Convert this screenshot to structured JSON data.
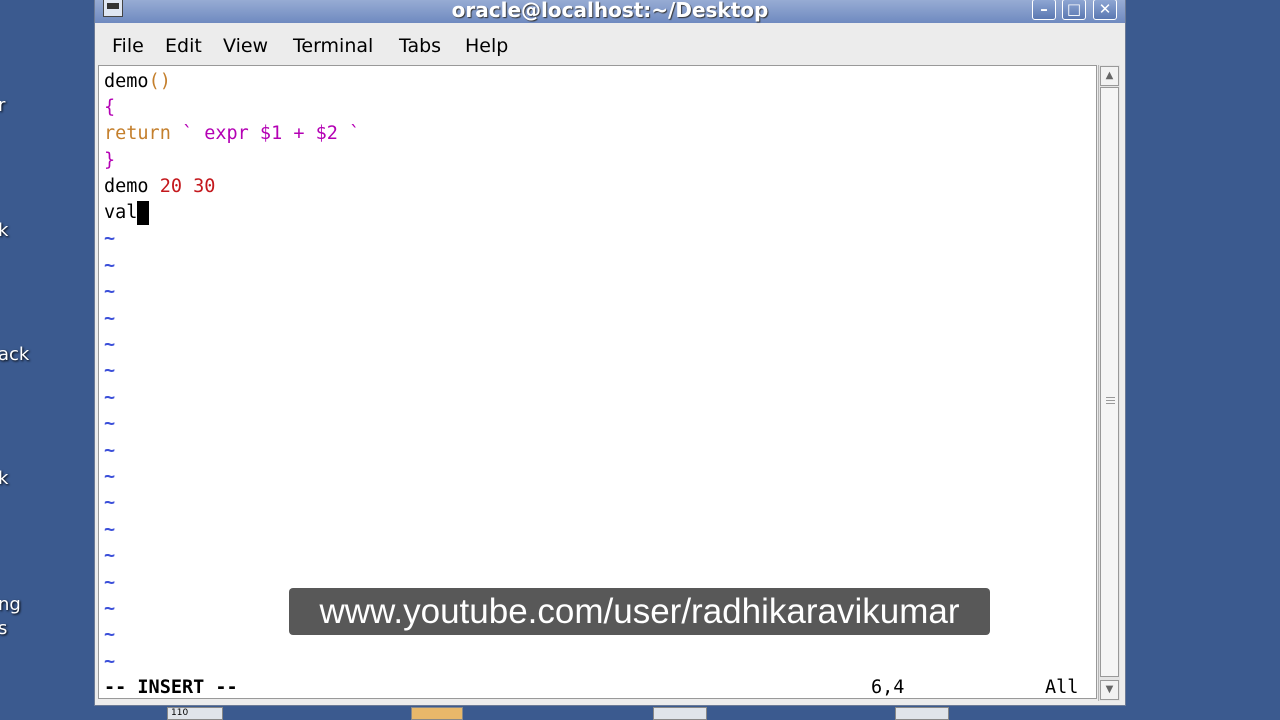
{
  "window": {
    "title": "oracle@localhost:~/Desktop"
  },
  "title_buttons": {
    "minimize": "–",
    "maximize": "□",
    "close": "✕"
  },
  "menu": [
    {
      "label": "File"
    },
    {
      "label": "Edit"
    },
    {
      "label": "View"
    },
    {
      "label": "Terminal"
    },
    {
      "label": "Tabs"
    },
    {
      "label": "Help"
    }
  ],
  "editor": {
    "lines": [
      {
        "text": "demo",
        "paren": "()"
      },
      {
        "text": "{"
      },
      {
        "keyword": "return",
        "rest": " ` expr $1 + $2 `"
      },
      {
        "text": "}"
      },
      {
        "cmd": "demo",
        "args": " 20 30"
      },
      {
        "text": "val"
      }
    ],
    "tilde": "~",
    "mode": "-- INSERT --",
    "position": "6,4",
    "scroll": "All"
  },
  "scroll_arrows": {
    "up": "▲",
    "down": "▼"
  },
  "desktop_labels": [
    "r",
    "k",
    "ack",
    "k",
    "ng",
    "s"
  ],
  "watermark": "www.youtube.com/user/radhikaravikumar",
  "taskbar": {
    "counter": "110"
  },
  "colors": {
    "desktop": "#3b5a8f",
    "keyword": "#c47f2c",
    "brace": "#b400b4",
    "number": "#c4181d",
    "tilde": "#3b4fd9"
  }
}
